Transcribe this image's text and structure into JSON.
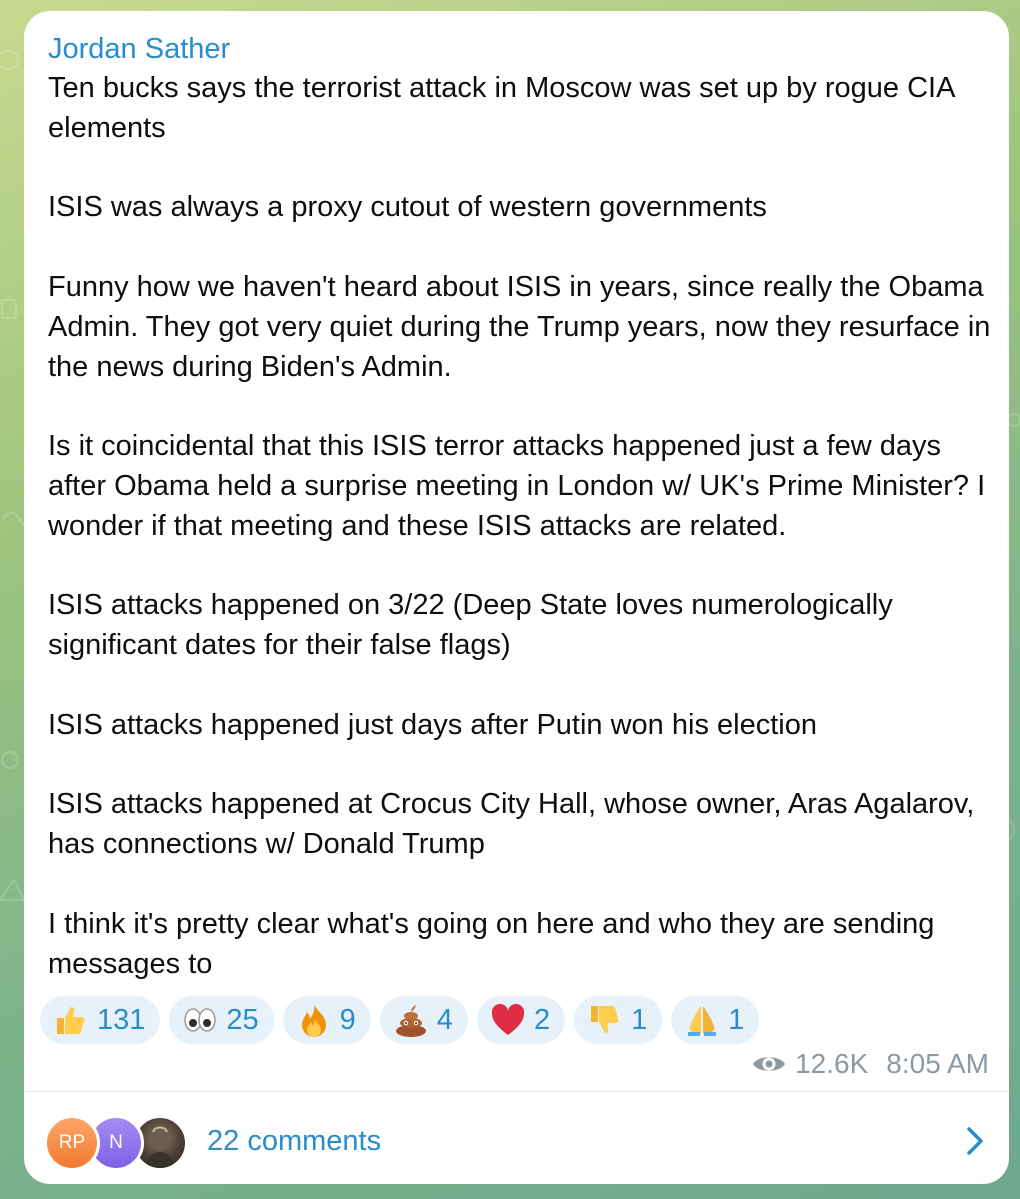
{
  "post": {
    "author": "Jordan Sather",
    "body": "Ten bucks says the terrorist attack in Moscow was set up by rogue CIA elements\n\nISIS was always a proxy cutout of western governments\n\nFunny how we haven't heard about ISIS in years, since really the Obama Admin. They got very quiet during the Trump years, now they resurface in the news during Biden's Admin.\n\nIs it coincidental that this ISIS terror attacks happened just a few days after Obama held a surprise meeting in London w/ UK's Prime Minister? I wonder if that meeting and these ISIS attacks are related.\n\nISIS attacks happened on 3/22 (Deep State loves numerologically significant dates for their false flags)\n\nISIS attacks happened just days after Putin won his election\n\nISIS attacks happened at Crocus City Hall, whose owner, Aras Agalarov, has connections w/ Donald Trump\n\nI think it's pretty clear what's going on here and who they are sending messages to",
    "views": "12.6K",
    "time": "8:05 AM"
  },
  "reactions": [
    {
      "icon": "thumbs-up-icon",
      "count": "131"
    },
    {
      "icon": "eyes-icon",
      "count": "25"
    },
    {
      "icon": "fire-icon",
      "count": "9"
    },
    {
      "icon": "poop-icon",
      "count": "4"
    },
    {
      "icon": "heart-icon",
      "count": "2"
    },
    {
      "icon": "thumbs-down-icon",
      "count": "1"
    },
    {
      "icon": "pray-icon",
      "count": "1"
    }
  ],
  "comments": {
    "avatars": [
      "RP",
      "N"
    ],
    "label": "22 comments"
  },
  "colors": {
    "accent": "#2a8dc9",
    "reaction_bg": "#e6f1fa",
    "meta": "#8e9aa3"
  }
}
